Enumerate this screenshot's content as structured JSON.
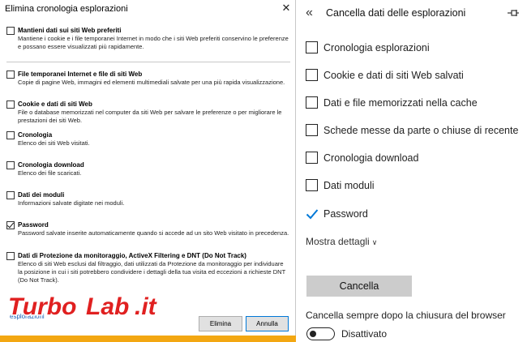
{
  "ie_dialog": {
    "title": "Elimina cronologia esplorazioni",
    "close_glyph": "✕",
    "options": [
      {
        "label": "Mantieni dati sui siti Web preferiti",
        "description": "Mantiene i cookie e i file temporanei Internet in modo che i siti Web preferiti conservino le preferenze e possano essere visualizzati più rapidamente.",
        "checked": false
      },
      {
        "label": "File temporanei Internet e file di siti Web",
        "description": "Copie di pagine Web, immagini ed elementi multimediali salvate per una più rapida visualizzazione.",
        "checked": false
      },
      {
        "label": "Cookie e dati di siti Web",
        "description": "File o database memorizzati nel computer da siti Web per salvare le preferenze o per migliorare le prestazioni dei siti Web.",
        "checked": false
      },
      {
        "label": "Cronologia",
        "description": "Elenco dei siti Web visitati.",
        "checked": false
      },
      {
        "label": "Cronologia download",
        "description": "Elenco dei file scaricati.",
        "checked": false
      },
      {
        "label": "Dati dei moduli",
        "description": "Informazioni salvate digitate nei moduli.",
        "checked": false
      },
      {
        "label": "Password",
        "description": "Password salvate inserite automaticamente quando si accede ad un sito Web visitato in precedenza.",
        "checked": true
      },
      {
        "label": "Dati di Protezione da monitoraggio, ActiveX Filtering e DNT (Do Not Track)",
        "description": "Elenco di siti Web esclusi dal filtraggio, dati utilizzati da Protezione da monitoraggio per individuare la posizione in cui i siti potrebbero condividere i dettagli della tua visita ed eccezioni a richieste DNT (Do Not Track).",
        "checked": false
      }
    ],
    "link_text": "esplorazioni",
    "delete_button": "Elimina",
    "cancel_button": "Annulla"
  },
  "watermark": {
    "text_a": "Turbo",
    "text_b": "Lab",
    "text_c": ".it",
    "color_red": "#e02020",
    "color_outline": "#ffffff"
  },
  "edge_panel": {
    "back_glyph": "«",
    "title": "Cancella dati delle esplorazioni",
    "options": [
      {
        "label": "Cronologia esplorazioni",
        "checked": false
      },
      {
        "label": "Cookie e dati di siti Web salvati",
        "checked": false
      },
      {
        "label": "Dati e file memorizzati nella cache",
        "checked": false
      },
      {
        "label": "Schede messe da parte o chiuse di recente",
        "checked": false
      },
      {
        "label": "Cronologia download",
        "checked": false
      },
      {
        "label": "Dati moduli",
        "checked": false
      },
      {
        "label": "Password",
        "checked": true
      }
    ],
    "show_details": "Mostra dettagli",
    "show_details_chevron": "∨",
    "clear_button": "Cancella",
    "always_clear_label": "Cancella sempre dopo la chiusura del browser",
    "toggle_state_label": "Disattivato",
    "accent_color": "#0078d7"
  }
}
